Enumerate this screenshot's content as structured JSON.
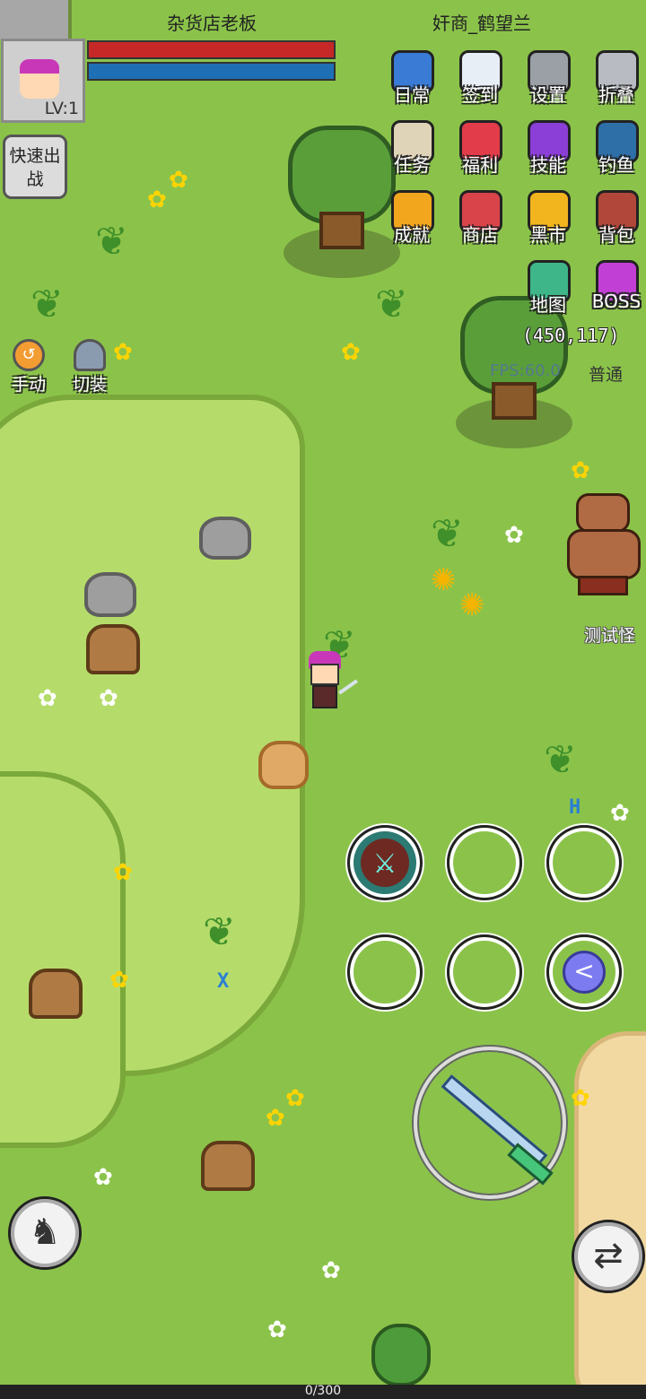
{
  "hud": {
    "npc_label": "杂货店老板",
    "player_name": "奸商_鹤望兰",
    "level": "LV:1",
    "quick_battle": "快速出战",
    "hp_fill": 1.0,
    "mp_fill": 1.0,
    "hp_color": "#c62828",
    "mp_color": "#1f6fb5"
  },
  "left_buttons": {
    "manual": "手动",
    "switch_gear": "切装"
  },
  "menu": [
    {
      "label": "日常",
      "icon": "daily-clipboard-icon",
      "color": "#3a7bd5"
    },
    {
      "label": "签到",
      "icon": "checkin-newspaper-icon",
      "color": "#e8eef5"
    },
    {
      "label": "设置",
      "icon": "settings-gear-icon",
      "color": "#9aa0a6"
    },
    {
      "label": "折叠",
      "icon": "collapse-gear-icon",
      "color": "#b8bcc2"
    },
    {
      "label": "任务",
      "icon": "quest-scroll-icon",
      "color": "#e0d4b8"
    },
    {
      "label": "福利",
      "icon": "gift-box-icon",
      "color": "#e23c4a"
    },
    {
      "label": "技能",
      "icon": "skill-book-icon",
      "color": "#8b3fd6"
    },
    {
      "label": "钓鱼",
      "icon": "fish-icon",
      "color": "#2e6fa8"
    },
    {
      "label": "成就",
      "icon": "trophy-icon",
      "color": "#f2a61e"
    },
    {
      "label": "商店",
      "icon": "shop-stall-icon",
      "color": "#d9434a"
    },
    {
      "label": "黑市",
      "icon": "crown-icon",
      "color": "#f2b51e"
    },
    {
      "label": "背包",
      "icon": "backpack-icon",
      "color": "#b0473a"
    },
    {
      "label": "地图",
      "icon": "map-icon",
      "color": "#3fb58a"
    },
    {
      "label": "BOSS",
      "icon": "boss-emblem-icon",
      "color": "#c23fd6"
    }
  ],
  "status": {
    "coords": "(450,117)",
    "fps": "FPS:60.0",
    "mode": "普通"
  },
  "world": {
    "monster_name": "测试怪",
    "marker_a": "H",
    "marker_b": "X"
  },
  "skills": {
    "collapse_glyph": "<",
    "slot1_glyph": "⚔"
  },
  "controls": {
    "mount_icon": "horse-icon",
    "swap_icon": "swap-arrows-icon"
  },
  "exp": {
    "text": "0/300"
  }
}
